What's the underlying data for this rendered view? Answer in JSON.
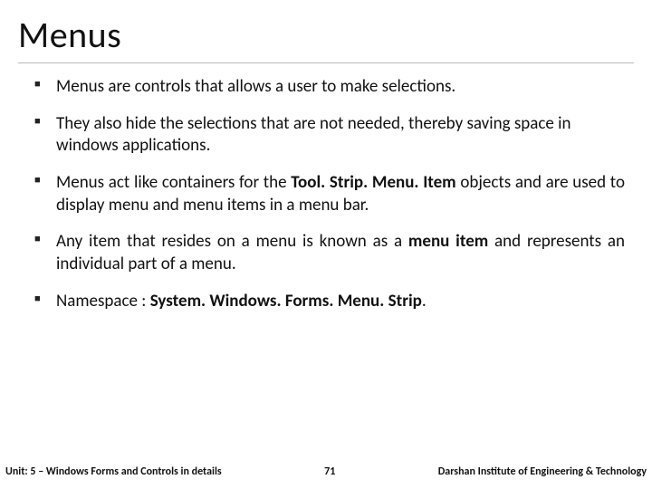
{
  "title": "Menus",
  "bullets": [
    {
      "pre": "Menus are controls that allows a user to make selections.",
      "bold": "",
      "post": ""
    },
    {
      "pre": "They also hide the selections that are not needed, thereby saving space in windows applications.",
      "bold": "",
      "post": ""
    },
    {
      "pre": "Menus act like containers for the ",
      "bold": "Tool. Strip. Menu. Item",
      "post": " objects and are used to display menu and menu items in a menu bar."
    },
    {
      "pre": "Any item that resides on a menu is known as a ",
      "bold": "menu item",
      "post": " and represents an individual part of a menu."
    },
    {
      "pre": "Namespace : ",
      "bold": "System. Windows. Forms. Menu. Strip",
      "post": "."
    }
  ],
  "footer": {
    "unit": "Unit: 5 – Windows Forms and Controls in details",
    "page": "71",
    "org": "Darshan Institute of Engineering & Technology"
  }
}
